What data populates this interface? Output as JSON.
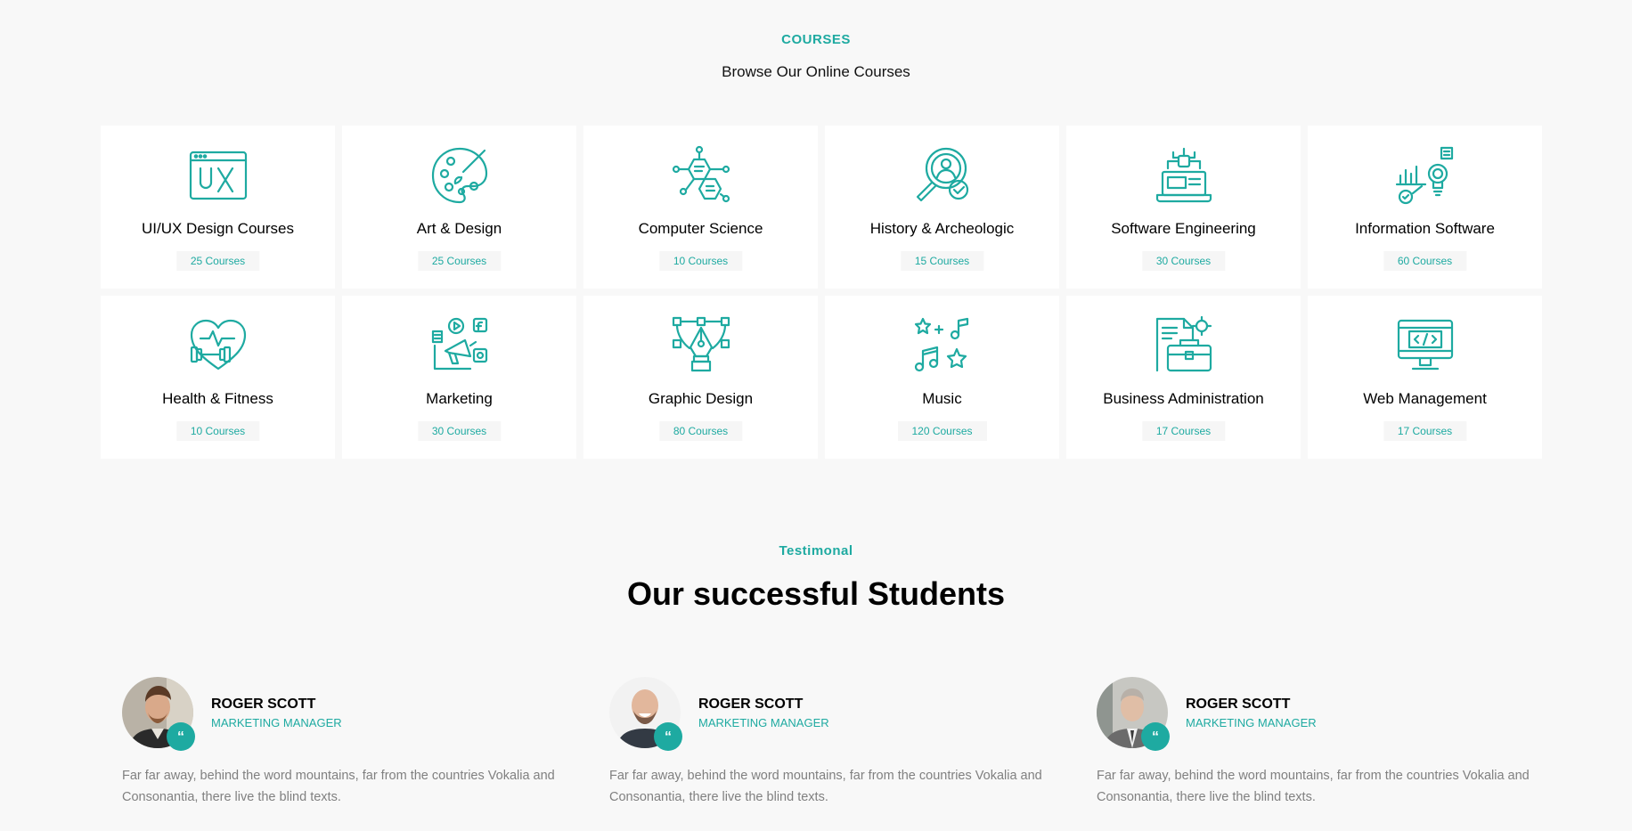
{
  "courses": {
    "eyebrow": "COURSES",
    "subtitle": "Browse Our Online Courses",
    "items": [
      {
        "title": "UI/UX Design Courses",
        "count": "25 Courses",
        "icon": "ux-screen-icon"
      },
      {
        "title": "Art & Design",
        "count": "25 Courses",
        "icon": "palette-icon"
      },
      {
        "title": "Computer Science",
        "count": "10 Courses",
        "icon": "network-icon"
      },
      {
        "title": "History & Archeologic",
        "count": "15 Courses",
        "icon": "magnifier-icon"
      },
      {
        "title": "Software Engineering",
        "count": "30 Courses",
        "icon": "laptop-icon"
      },
      {
        "title": "Information Software",
        "count": "60 Courses",
        "icon": "bulb-chart-icon"
      },
      {
        "title": "Health & Fitness",
        "count": "10 Courses",
        "icon": "heart-dumbbell-icon"
      },
      {
        "title": "Marketing",
        "count": "30 Courses",
        "icon": "megaphone-icon"
      },
      {
        "title": "Graphic Design",
        "count": "80 Courses",
        "icon": "pen-tool-icon"
      },
      {
        "title": "Music",
        "count": "120 Courses",
        "icon": "music-notes-icon"
      },
      {
        "title": "Business Administration",
        "count": "17 Courses",
        "icon": "briefcase-icon"
      },
      {
        "title": "Web Management",
        "count": "17 Courses",
        "icon": "monitor-code-icon"
      }
    ]
  },
  "testimonial": {
    "eyebrow": "Testimonal",
    "title": "Our successful Students",
    "items": [
      {
        "name": "ROGER SCOTT",
        "role": "MARKETING MANAGER",
        "text": "Far far away, behind the word mountains, far from the countries Vokalia and Consonantia, there live the blind texts."
      },
      {
        "name": "ROGER SCOTT",
        "role": "MARKETING MANAGER",
        "text": "Far far away, behind the word mountains, far from the countries Vokalia and Consonantia, there live the blind texts."
      },
      {
        "name": "ROGER SCOTT",
        "role": "MARKETING MANAGER",
        "text": "Far far away, behind the word mountains, far from the countries Vokalia and Consonantia, there live the blind texts."
      }
    ],
    "quote_glyph": "“"
  },
  "colors": {
    "accent": "#1eaaa1",
    "background": "#f8f8f8",
    "card": "#ffffff",
    "badge_bg": "#f6f6f6",
    "body_text": "#808080"
  }
}
